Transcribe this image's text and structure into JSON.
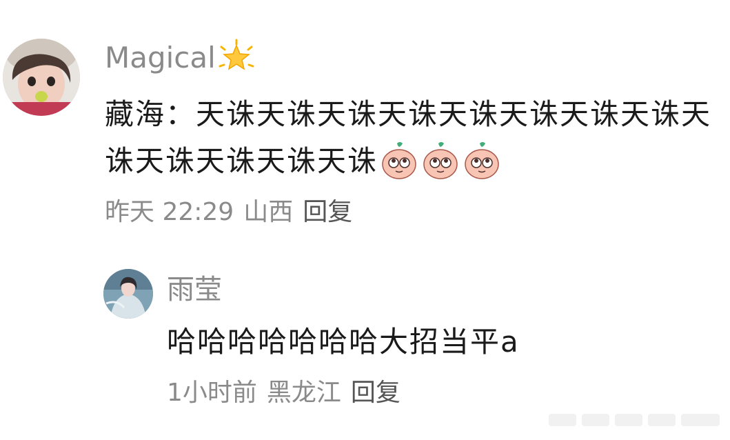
{
  "comment": {
    "username": "Magical",
    "text": "藏海：天诛天诛天诛天诛天诛天诛天诛天诛天诛天诛天诛天诛天诛",
    "emoji_count": 3,
    "time": "昨天 22:29",
    "location": "山西",
    "reply_label": "回复"
  },
  "reply": {
    "username": "雨莹",
    "text": "哈哈哈哈哈哈哈大招当平a",
    "time": "1小时前",
    "location": "黑龙江",
    "reply_label": "回复"
  },
  "colors": {
    "username": "#8a8a8a",
    "text": "#1a1a1a",
    "meta": "#8a8a8a",
    "reply_link": "#555555"
  },
  "icons": {
    "username_badge": "star-icon",
    "emoji": "peach-eyes-emoji"
  }
}
